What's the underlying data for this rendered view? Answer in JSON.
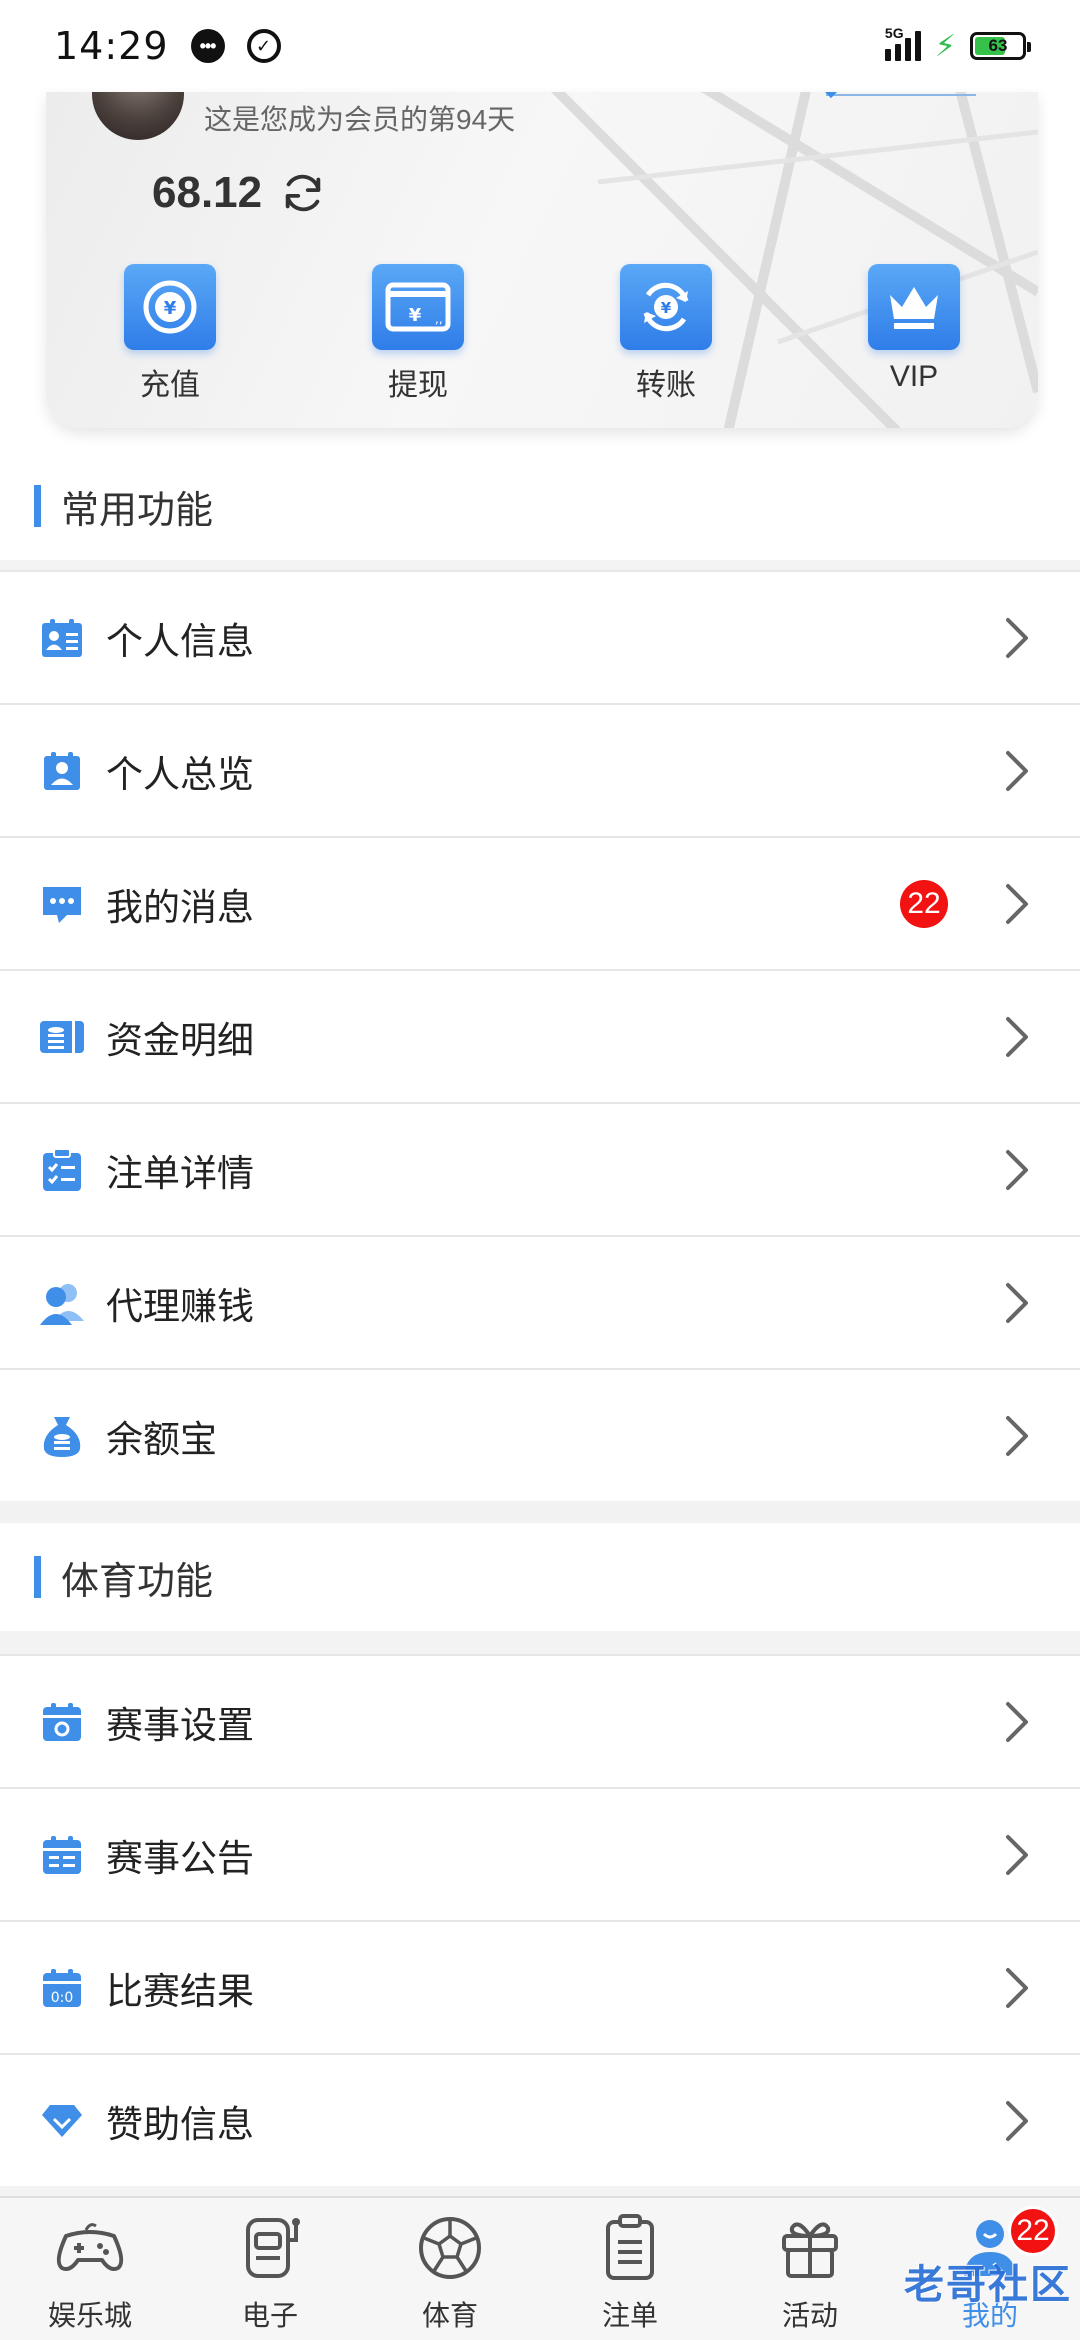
{
  "status_bar": {
    "time": "14:29",
    "network": "5G",
    "battery": "63"
  },
  "member_card": {
    "days_text": "这是您成为会员的第94天",
    "balance": "68.12",
    "actions": [
      {
        "label": "充值",
        "icon": "yuan-coin-icon"
      },
      {
        "label": "提现",
        "icon": "withdraw-card-icon"
      },
      {
        "label": "转账",
        "icon": "transfer-icon"
      },
      {
        "label": "VIP",
        "icon": "crown-icon"
      }
    ]
  },
  "common_section": {
    "title": "常用功能",
    "items": [
      {
        "label": "个人信息",
        "icon": "id-card-icon"
      },
      {
        "label": "个人总览",
        "icon": "profile-overview-icon"
      },
      {
        "label": "我的消息",
        "icon": "chat-bubble-icon",
        "badge": "22"
      },
      {
        "label": "资金明细",
        "icon": "wallet-detail-icon"
      },
      {
        "label": "注单详情",
        "icon": "checklist-icon"
      },
      {
        "label": "代理赚钱",
        "icon": "agent-users-icon"
      },
      {
        "label": "余额宝",
        "icon": "money-bag-icon"
      }
    ]
  },
  "sports_section": {
    "title": "体育功能",
    "items": [
      {
        "label": "赛事设置",
        "icon": "calendar-settings-icon"
      },
      {
        "label": "赛事公告",
        "icon": "calendar-notice-icon"
      },
      {
        "label": "比赛结果",
        "icon": "calendar-score-icon"
      },
      {
        "label": "赞助信息",
        "icon": "diamond-icon"
      }
    ]
  },
  "bottom_nav": {
    "items": [
      {
        "label": "娱乐城",
        "icon": "gamepad-icon"
      },
      {
        "label": "电子",
        "icon": "slot-machine-icon"
      },
      {
        "label": "体育",
        "icon": "soccer-ball-icon"
      },
      {
        "label": "注单",
        "icon": "clipboard-icon"
      },
      {
        "label": "活动",
        "icon": "gift-icon"
      },
      {
        "label": "我的",
        "icon": "user-icon",
        "badge": "22"
      }
    ]
  },
  "watermark": "老哥社区",
  "colors": {
    "accent": "#3f8ee8",
    "badge": "#f21212"
  }
}
